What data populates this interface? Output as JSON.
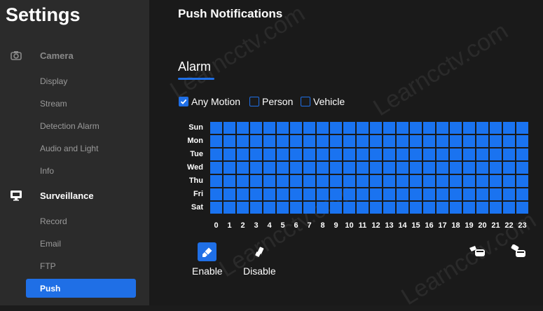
{
  "app": {
    "title": "Settings"
  },
  "sidebar": {
    "camera_section": "Camera",
    "camera_items": [
      "Display",
      "Stream",
      "Detection Alarm",
      "Audio and Light",
      "Info"
    ],
    "surveillance_section": "Surveillance",
    "surveillance_items": [
      "Record",
      "Email",
      "FTP",
      "Push"
    ],
    "active_item": "Push"
  },
  "main": {
    "title": "Push Notifications",
    "tab": "Alarm",
    "filters": [
      {
        "label": "Any Motion",
        "checked": true
      },
      {
        "label": "Person",
        "checked": false
      },
      {
        "label": "Vehicle",
        "checked": false
      }
    ],
    "schedule": {
      "days": [
        "Sun",
        "Mon",
        "Tue",
        "Wed",
        "Thu",
        "Fri",
        "Sat"
      ],
      "hours": [
        "0",
        "1",
        "2",
        "3",
        "4",
        "5",
        "6",
        "7",
        "8",
        "9",
        "10",
        "11",
        "12",
        "13",
        "14",
        "15",
        "16",
        "17",
        "18",
        "19",
        "20",
        "21",
        "22",
        "23"
      ],
      "all_enabled": true,
      "cell_color": "#1a73f0"
    },
    "actions": {
      "enable_label": "Enable",
      "disable_label": "Disable",
      "enable_icon": "brush-icon",
      "disable_icon": "eraser-icon",
      "undo_icon": "undo-hand-icon",
      "redo_icon": "redo-hand-icon"
    }
  },
  "colors": {
    "accent": "#1f6fe6",
    "sidebar_bg": "#2b2b2b",
    "main_bg": "#1a1a1a"
  }
}
